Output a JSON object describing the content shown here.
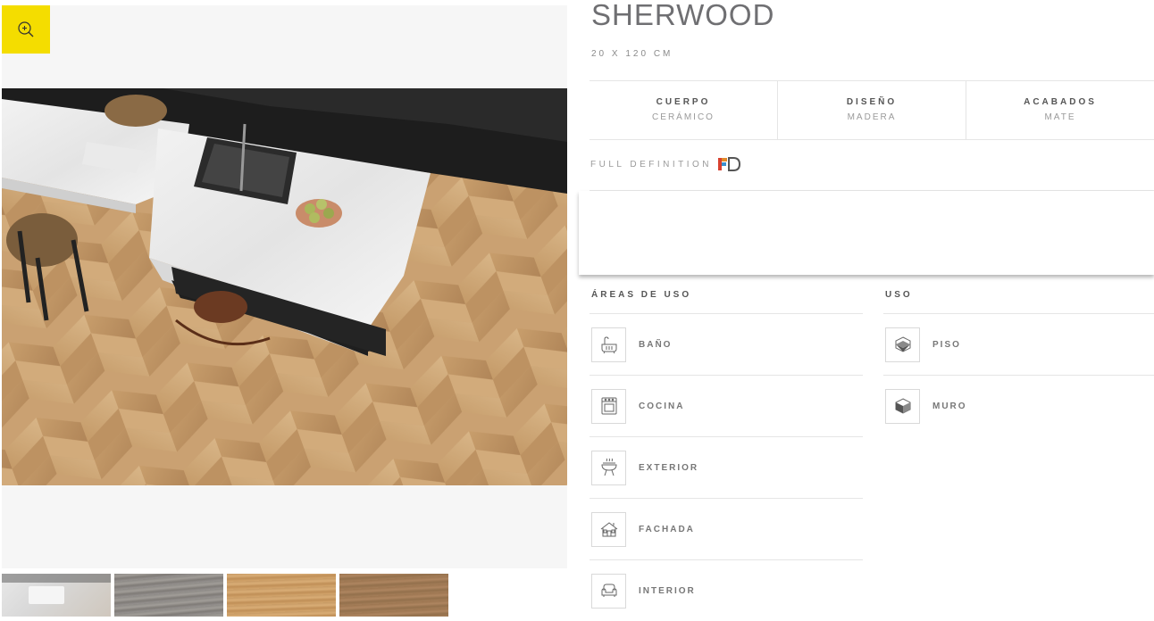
{
  "product": {
    "name": "SHERWOOD",
    "size": "20 X 120 CM"
  },
  "specs": [
    {
      "label": "CUERPO",
      "value": "CERÁMICO"
    },
    {
      "label": "DISEÑO",
      "value": "MADERA"
    },
    {
      "label": "ACABADOS",
      "value": "MATE"
    }
  ],
  "full_definition": {
    "label": "FULL DEFINITION",
    "badge_icon": "fd-logo-icon"
  },
  "areas": {
    "heading": "ÁREAS DE USO",
    "items": [
      {
        "label": "BAÑO",
        "icon": "bathtub-icon"
      },
      {
        "label": "COCINA",
        "icon": "oven-icon"
      },
      {
        "label": "EXTERIOR",
        "icon": "grill-icon"
      },
      {
        "label": "FACHADA",
        "icon": "house-facade-icon"
      },
      {
        "label": "INTERIOR",
        "icon": "armchair-icon"
      }
    ]
  },
  "uso": {
    "heading": "USO",
    "items": [
      {
        "label": "PISO",
        "icon": "floor-cube-icon"
      },
      {
        "label": "MURO",
        "icon": "wall-cube-icon"
      }
    ]
  },
  "gallery": {
    "zoom_icon": "zoom-in-icon",
    "accent": "#f4dd00",
    "thumbnails": 4
  }
}
